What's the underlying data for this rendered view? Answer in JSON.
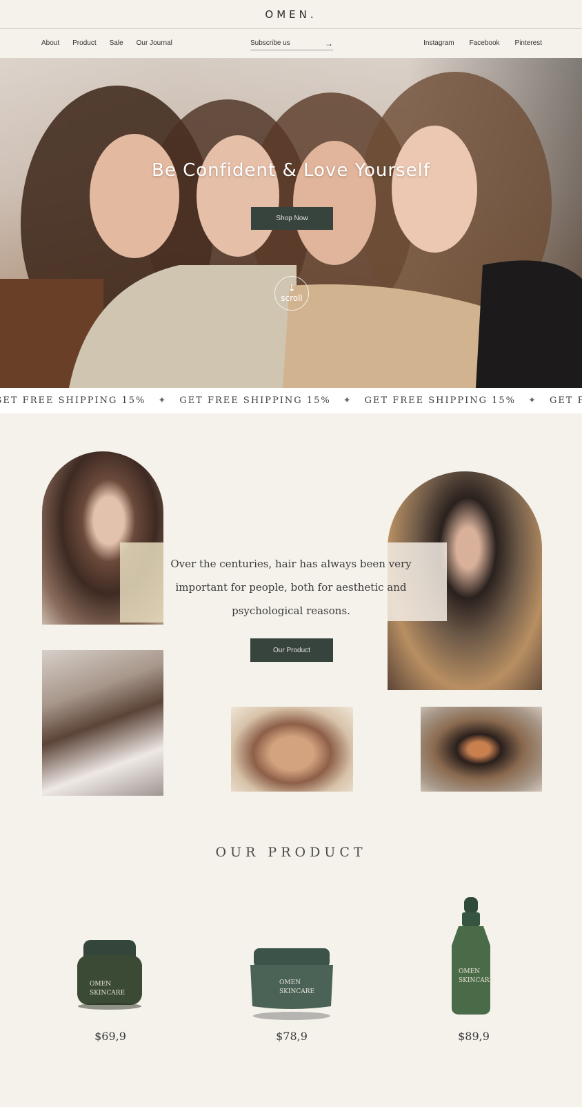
{
  "brand": {
    "logo": "OMEN."
  },
  "nav": {
    "left": [
      "About",
      "Product",
      "Sale",
      "Our Journal"
    ],
    "subscribe_placeholder": "Subscribe us",
    "right": [
      "Instagram",
      "Facebook",
      "Pinterest"
    ]
  },
  "hero": {
    "title": "Be Confident & Love Yourself",
    "cta": "Shop Now",
    "scroll_label": "scroll"
  },
  "marquee": {
    "text": "GET FREE SHIPPING 15%",
    "repeat_count": 4
  },
  "about": {
    "text": "Over the centuries, hair has always been very important for people, both for aesthetic and psychological reasons.",
    "cta": "Our Product"
  },
  "products": {
    "title": "OUR PRODUCT",
    "items": [
      {
        "label": "OMEN SKINCARE",
        "price": "$69,9"
      },
      {
        "label": "OMEN SKINCARE",
        "price": "$78,9"
      },
      {
        "label": "OMEN SKINCARE",
        "price": "$89,9"
      }
    ]
  },
  "colors": {
    "background": "#f5f1eb",
    "button": "#37433d",
    "product_green": "#3f5a4a"
  }
}
